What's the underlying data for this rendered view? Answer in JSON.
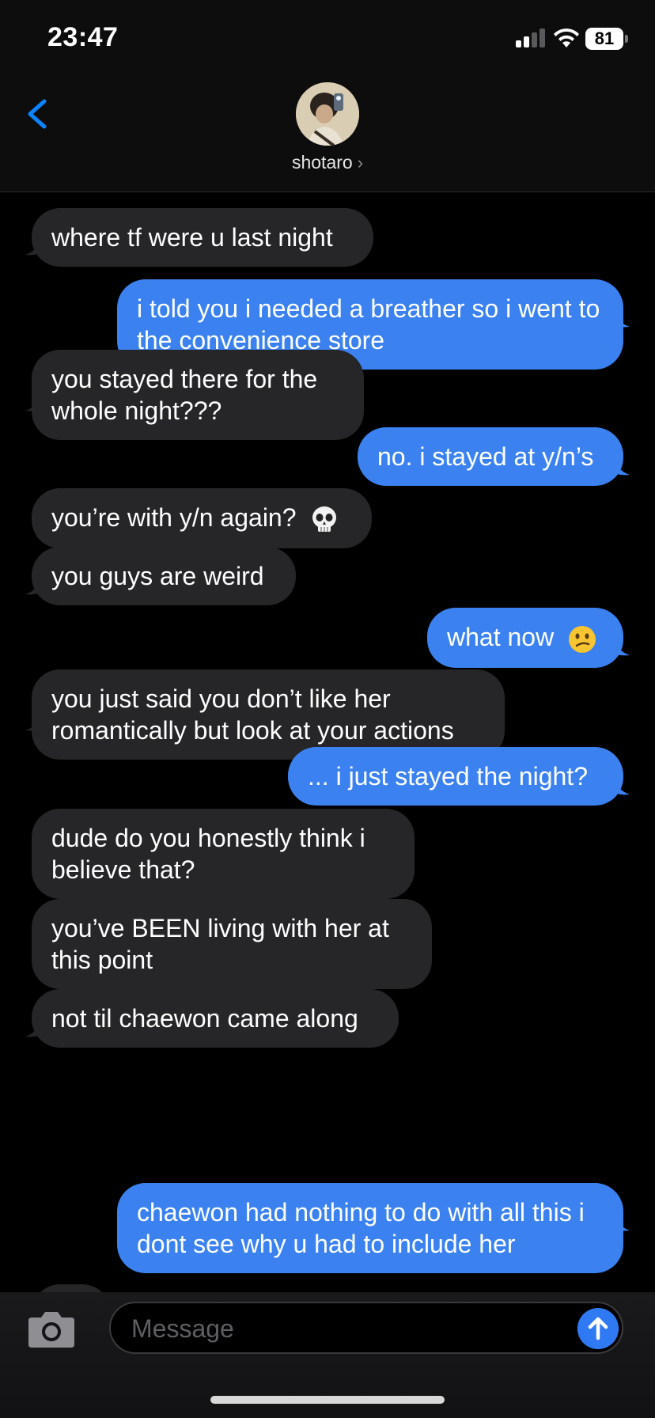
{
  "status_bar": {
    "time": "23:47",
    "battery": "81"
  },
  "header": {
    "contact_name": "shotaro",
    "back_icon": "chevron-left-icon",
    "accent_color": "#0a84ff"
  },
  "messages": [
    {
      "side": "in",
      "text": "where tf were u last night"
    },
    {
      "side": "out",
      "text": "i told you i needed a breather so i went to the convenience store"
    },
    {
      "side": "in",
      "text": "you stayed there for the whole night???"
    },
    {
      "side": "out",
      "text": "no. i stayed at y/n’s"
    },
    {
      "side": "in",
      "text": "you’re with y/n again?",
      "emoji": "skull"
    },
    {
      "side": "in",
      "text": "you guys are weird"
    },
    {
      "side": "out",
      "text": "what now",
      "emoji": "confused-face"
    },
    {
      "side": "in",
      "text": "you just said you don’t like her romantically but look at your actions"
    },
    {
      "side": "out",
      "text": "... i just stayed the night?"
    },
    {
      "side": "in",
      "text": "dude do you honestly think i believe that?"
    },
    {
      "side": "in",
      "text": "you’ve BEEN living with her at this point"
    },
    {
      "side": "in",
      "text": "not til chaewon came along"
    },
    {
      "side": "out",
      "text": "chaewon had nothing to do with all this i dont see why u had to include her"
    }
  ],
  "composer": {
    "placeholder": "Message",
    "camera_icon": "camera-icon",
    "send_icon": "arrow-up-icon"
  },
  "colors": {
    "incoming_bubble": "#262628",
    "outgoing_bubble": "#3b82f0",
    "background": "#000000"
  }
}
